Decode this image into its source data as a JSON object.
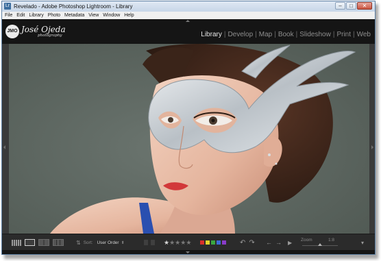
{
  "window": {
    "title": "Revelado - Adobe Photoshop Lightroom - Library",
    "app_icon": "Lr",
    "controls": {
      "minimize": "–",
      "maximize": "□",
      "close": "✕"
    }
  },
  "menu": [
    "File",
    "Edit",
    "Library",
    "Photo",
    "Metadata",
    "View",
    "Window",
    "Help"
  ],
  "identity_plate": {
    "monogram": "JMO",
    "name": "José Ojeda",
    "tagline": "photography"
  },
  "modules": [
    "Library",
    "Develop",
    "Map",
    "Book",
    "Slideshow",
    "Print",
    "Web"
  ],
  "active_module": "Library",
  "photo": {
    "description_icon": "portrait-photo"
  },
  "toolbar": {
    "sort_label": "Sort:",
    "sort_value": "User Order",
    "stars": [
      "★",
      "★",
      "★",
      "★",
      "★"
    ],
    "color_labels": [
      "#d8302b",
      "#e3d32a",
      "#3aa640",
      "#3c6ad7",
      "#8a3cc9"
    ],
    "zoom_label": "Zoom",
    "zoom_value": "1:8",
    "zoom_level": 0.5,
    "menu_arrow": "▾"
  },
  "colors": {
    "accent": "#5d7fa3",
    "background": "#1d1d1d"
  }
}
